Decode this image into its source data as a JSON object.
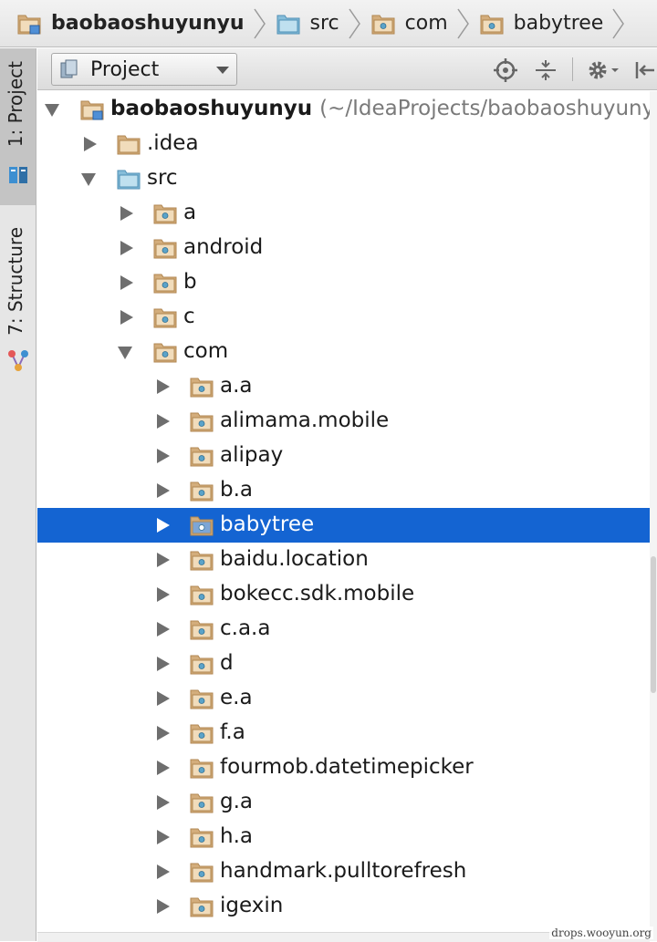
{
  "breadcrumb": [
    {
      "label": "baobaoshuyunyu",
      "icon": "module-folder-icon",
      "bold": true
    },
    {
      "label": "src",
      "icon": "source-folder-icon",
      "bold": false
    },
    {
      "label": "com",
      "icon": "package-icon",
      "bold": false
    },
    {
      "label": "babytree",
      "icon": "package-icon",
      "bold": false
    }
  ],
  "side_tabs": {
    "project": "1: Project",
    "structure": "7: Structure"
  },
  "panel": {
    "view_label": "Project",
    "tools": [
      "locate-icon",
      "collapse-all-icon",
      "gear-icon",
      "hide-panel-icon"
    ]
  },
  "tree": [
    {
      "label": "baobaoshuyunyu",
      "path": "(~/IdeaProjects/baobaoshuyunyu)",
      "level": 0,
      "state": "expanded",
      "icon": "module",
      "bold": true
    },
    {
      "label": ".idea",
      "level": 1,
      "state": "collapsed",
      "icon": "folder"
    },
    {
      "label": "src",
      "level": 1,
      "state": "expanded",
      "icon": "source"
    },
    {
      "label": "a",
      "level": 2,
      "state": "collapsed",
      "icon": "package"
    },
    {
      "label": "android",
      "level": 2,
      "state": "collapsed",
      "icon": "package"
    },
    {
      "label": "b",
      "level": 2,
      "state": "collapsed",
      "icon": "package"
    },
    {
      "label": "c",
      "level": 2,
      "state": "collapsed",
      "icon": "package"
    },
    {
      "label": "com",
      "level": 2,
      "state": "expanded",
      "icon": "package"
    },
    {
      "label": "a.a",
      "level": 3,
      "state": "collapsed",
      "icon": "package"
    },
    {
      "label": "alimama.mobile",
      "level": 3,
      "state": "collapsed",
      "icon": "package"
    },
    {
      "label": "alipay",
      "level": 3,
      "state": "collapsed",
      "icon": "package"
    },
    {
      "label": "b.a",
      "level": 3,
      "state": "collapsed",
      "icon": "package"
    },
    {
      "label": "babytree",
      "level": 3,
      "state": "collapsed",
      "icon": "package",
      "selected": true
    },
    {
      "label": "baidu.location",
      "level": 3,
      "state": "collapsed",
      "icon": "package"
    },
    {
      "label": "bokecc.sdk.mobile",
      "level": 3,
      "state": "collapsed",
      "icon": "package"
    },
    {
      "label": "c.a.a",
      "level": 3,
      "state": "collapsed",
      "icon": "package"
    },
    {
      "label": "d",
      "level": 3,
      "state": "collapsed",
      "icon": "package"
    },
    {
      "label": "e.a",
      "level": 3,
      "state": "collapsed",
      "icon": "package"
    },
    {
      "label": "f.a",
      "level": 3,
      "state": "collapsed",
      "icon": "package"
    },
    {
      "label": "fourmob.datetimepicker",
      "level": 3,
      "state": "collapsed",
      "icon": "package"
    },
    {
      "label": "g.a",
      "level": 3,
      "state": "collapsed",
      "icon": "package"
    },
    {
      "label": "h.a",
      "level": 3,
      "state": "collapsed",
      "icon": "package"
    },
    {
      "label": "handmark.pulltorefresh",
      "level": 3,
      "state": "collapsed",
      "icon": "package"
    },
    {
      "label": "igexin",
      "level": 3,
      "state": "collapsed",
      "icon": "package"
    }
  ],
  "colors": {
    "selection": "#1464d2",
    "folder": "#d3ad7c",
    "source_folder": "#86bdd9",
    "package_dot": "#5ba3c9"
  },
  "watermark": "drops.wooyun.org"
}
